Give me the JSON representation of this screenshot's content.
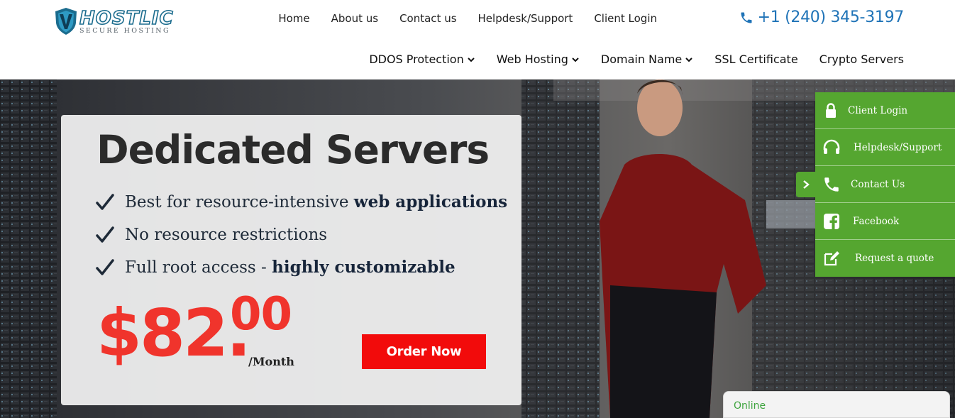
{
  "brand": {
    "name": "HOSTLIC",
    "tagline": "SECURE HOSTING"
  },
  "topnav": {
    "items": [
      {
        "label": "Home"
      },
      {
        "label": "About us"
      },
      {
        "label": "Contact us"
      },
      {
        "label": "Helpdesk/Support"
      },
      {
        "label": "Client Login"
      }
    ],
    "phone": "+1 (240) 345-3197"
  },
  "mainnav": {
    "items": [
      {
        "label": "DDOS Protection",
        "has_dropdown": true
      },
      {
        "label": "Web Hosting",
        "has_dropdown": true
      },
      {
        "label": "Domain Name",
        "has_dropdown": true
      },
      {
        "label": "SSL Certificate",
        "has_dropdown": false
      },
      {
        "label": "Crypto Servers",
        "has_dropdown": false
      }
    ]
  },
  "hero": {
    "title": "Dedicated Servers",
    "features": [
      {
        "text": "Best for resource-intensive ",
        "bold": "web applications"
      },
      {
        "text": "No resource restrictions",
        "bold": ""
      },
      {
        "text": "Full root access - ",
        "bold": "highly customizable"
      }
    ],
    "price": {
      "main": "$82.",
      "cents": "00",
      "period": "/Month"
    },
    "cta": "Order Now"
  },
  "side_panel": {
    "items": [
      {
        "label": "Client Login",
        "icon": "lock-icon"
      },
      {
        "label": "Helpdesk/Support",
        "icon": "headset-icon"
      },
      {
        "label": "Contact Us",
        "icon": "phone-icon"
      },
      {
        "label": "Facebook",
        "icon": "facebook-icon"
      },
      {
        "label": "Request a quote",
        "icon": "edit-icon"
      }
    ]
  },
  "chat": {
    "status": "Online"
  },
  "colors": {
    "accent_green": "#55a630",
    "price_red": "#f0342c",
    "cta_red": "#f20b0b",
    "phone_blue": "#1f73b7",
    "brand_teal": "#1b6c8e"
  }
}
